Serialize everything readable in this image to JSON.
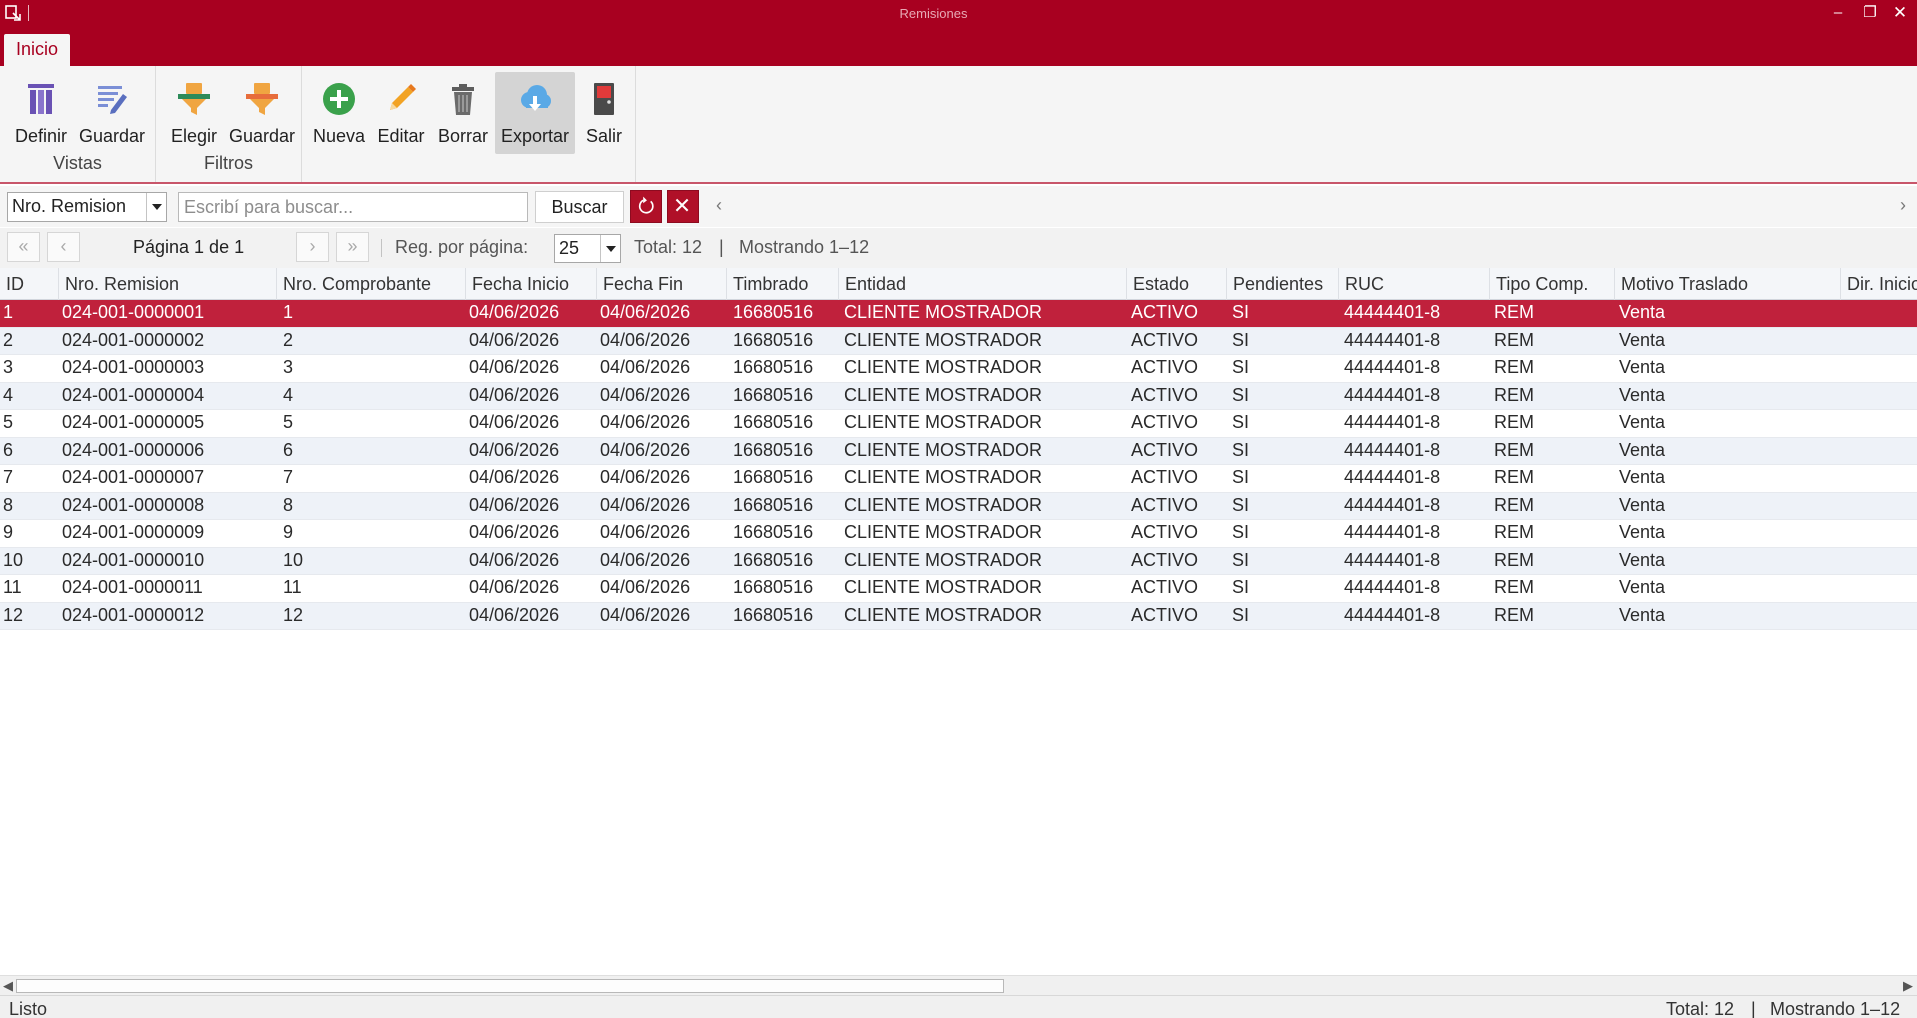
{
  "window": {
    "title": "Remisiones"
  },
  "ribbon": {
    "tab": "Inicio",
    "groups": [
      {
        "label": "Vistas",
        "buttons": [
          {
            "label": "Definir",
            "icon": "columns-icon"
          },
          {
            "label": "Guardar",
            "icon": "save-view-icon"
          }
        ]
      },
      {
        "label": "Filtros",
        "buttons": [
          {
            "label": "Elegir",
            "icon": "filter-choose-icon"
          },
          {
            "label": "Guardar",
            "icon": "filter-save-icon"
          }
        ]
      },
      {
        "label": "",
        "buttons": [
          {
            "label": "Nueva",
            "icon": "plus-circle-icon"
          },
          {
            "label": "Editar",
            "icon": "pencil-icon"
          },
          {
            "label": "Borrar",
            "icon": "trash-icon"
          },
          {
            "label": "Exportar",
            "icon": "cloud-download-icon"
          },
          {
            "label": "Salir",
            "icon": "door-exit-icon"
          }
        ]
      }
    ]
  },
  "search": {
    "field": "Nro. Remision",
    "placeholder": "Escribí para buscar...",
    "button": "Buscar"
  },
  "pager": {
    "first": "«",
    "prev": "‹",
    "page_text": "Página 1 de 1",
    "next": "›",
    "last": "»",
    "per_page_label": "Reg. por página:",
    "per_page": "25",
    "total": "Total: 12",
    "sep": "|",
    "showing": "Mostrando 1–12"
  },
  "grid": {
    "columns": [
      "ID",
      "Nro. Remision",
      "Nro. Comprobante",
      "Fecha Inicio",
      "Fecha Fin",
      "Timbrado",
      "Entidad",
      "Estado",
      "Pendientes",
      "RUC",
      "Tipo Comp.",
      "Motivo Traslado",
      "Dir. Inicio"
    ],
    "rows": [
      [
        "1",
        "024-001-0000001",
        "1",
        "04/06/2026",
        "04/06/2026",
        "16680516",
        "CLIENTE MOSTRADOR",
        "ACTIVO",
        "SI",
        "44444401-8",
        "REM",
        "Venta",
        ""
      ],
      [
        "2",
        "024-001-0000002",
        "2",
        "04/06/2026",
        "04/06/2026",
        "16680516",
        "CLIENTE MOSTRADOR",
        "ACTIVO",
        "SI",
        "44444401-8",
        "REM",
        "Venta",
        ""
      ],
      [
        "3",
        "024-001-0000003",
        "3",
        "04/06/2026",
        "04/06/2026",
        "16680516",
        "CLIENTE MOSTRADOR",
        "ACTIVO",
        "SI",
        "44444401-8",
        "REM",
        "Venta",
        ""
      ],
      [
        "4",
        "024-001-0000004",
        "4",
        "04/06/2026",
        "04/06/2026",
        "16680516",
        "CLIENTE MOSTRADOR",
        "ACTIVO",
        "SI",
        "44444401-8",
        "REM",
        "Venta",
        ""
      ],
      [
        "5",
        "024-001-0000005",
        "5",
        "04/06/2026",
        "04/06/2026",
        "16680516",
        "CLIENTE MOSTRADOR",
        "ACTIVO",
        "SI",
        "44444401-8",
        "REM",
        "Venta",
        ""
      ],
      [
        "6",
        "024-001-0000006",
        "6",
        "04/06/2026",
        "04/06/2026",
        "16680516",
        "CLIENTE MOSTRADOR",
        "ACTIVO",
        "SI",
        "44444401-8",
        "REM",
        "Venta",
        ""
      ],
      [
        "7",
        "024-001-0000007",
        "7",
        "04/06/2026",
        "04/06/2026",
        "16680516",
        "CLIENTE MOSTRADOR",
        "ACTIVO",
        "SI",
        "44444401-8",
        "REM",
        "Venta",
        ""
      ],
      [
        "8",
        "024-001-0000008",
        "8",
        "04/06/2026",
        "04/06/2026",
        "16680516",
        "CLIENTE MOSTRADOR",
        "ACTIVO",
        "SI",
        "44444401-8",
        "REM",
        "Venta",
        ""
      ],
      [
        "9",
        "024-001-0000009",
        "9",
        "04/06/2026",
        "04/06/2026",
        "16680516",
        "CLIENTE MOSTRADOR",
        "ACTIVO",
        "SI",
        "44444401-8",
        "REM",
        "Venta",
        ""
      ],
      [
        "10",
        "024-001-0000010",
        "10",
        "04/06/2026",
        "04/06/2026",
        "16680516",
        "CLIENTE MOSTRADOR",
        "ACTIVO",
        "SI",
        "44444401-8",
        "REM",
        "Venta",
        ""
      ],
      [
        "11",
        "024-001-0000011",
        "11",
        "04/06/2026",
        "04/06/2026",
        "16680516",
        "CLIENTE MOSTRADOR",
        "ACTIVO",
        "SI",
        "44444401-8",
        "REM",
        "Venta",
        ""
      ],
      [
        "12",
        "024-001-0000012",
        "12",
        "04/06/2026",
        "04/06/2026",
        "16680516",
        "CLIENTE MOSTRADOR",
        "ACTIVO",
        "SI",
        "44444401-8",
        "REM",
        "Venta",
        ""
      ]
    ]
  },
  "status": {
    "left": "Listo",
    "total": "Total: 12",
    "sep": "|",
    "showing": "Mostrando 1–12"
  },
  "colors": {
    "accent": "#a80020",
    "selected_row": "#c0213c",
    "alt_row": "#eef2f8"
  }
}
